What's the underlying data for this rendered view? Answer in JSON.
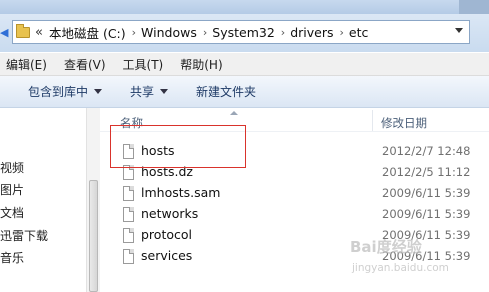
{
  "address": {
    "overflow_chevron": "«",
    "crumbs": [
      "本地磁盘 (C:)",
      "Windows",
      "System32",
      "drivers",
      "etc"
    ],
    "separator": "›"
  },
  "menu": [
    "编辑(E)",
    "查看(V)",
    "工具(T)",
    "帮助(H)"
  ],
  "toolbar": {
    "include_in_library": "包含到库中",
    "share": "共享",
    "new_folder": "新建文件夹"
  },
  "nav": [
    "视频",
    "图片",
    "文档",
    "迅雷下载",
    "音乐"
  ],
  "columns": {
    "name": "名称",
    "date_modified": "修改日期"
  },
  "files": [
    {
      "name": "hosts",
      "date": "2012/2/7 12:48"
    },
    {
      "name": "hosts.dz",
      "date": "2012/2/5 11:12"
    },
    {
      "name": "lmhosts.sam",
      "date": "2009/6/11 5:39"
    },
    {
      "name": "networks",
      "date": "2009/6/11 5:39"
    },
    {
      "name": "protocol",
      "date": "2009/6/11 5:39"
    },
    {
      "name": "services",
      "date": "2009/6/11 5:39"
    }
  ],
  "watermark": {
    "text": "Bai度经验",
    "url": "jingyan.baidu.com"
  },
  "colors": {
    "highlight_border": "#d9332c",
    "toolbar_text": "#1e3a66"
  }
}
